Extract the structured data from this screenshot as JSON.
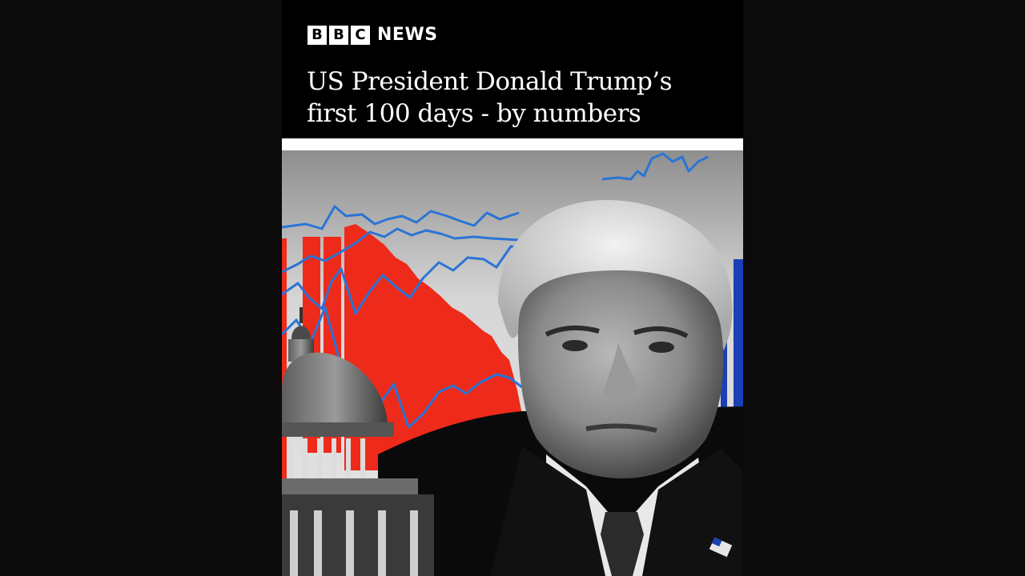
{
  "brand": {
    "logo_letters": [
      "B",
      "B",
      "C"
    ],
    "logo_word": "NEWS"
  },
  "article": {
    "headline_line1": "US President Donald Trump’s",
    "headline_line2": "first 100 days - by numbers"
  },
  "image": {
    "subject": "portrait-collage",
    "elements": [
      "portrait",
      "capitol-dome",
      "red-area-chart",
      "blue-line-chart",
      "us-flag-pin"
    ]
  },
  "colors": {
    "background": "#0b0b0b",
    "card": "#000000",
    "text": "#ffffff",
    "chart_red": "#ee2a1a",
    "chart_blue": "#2a74d6",
    "flag_blue": "#1b3fb6"
  }
}
